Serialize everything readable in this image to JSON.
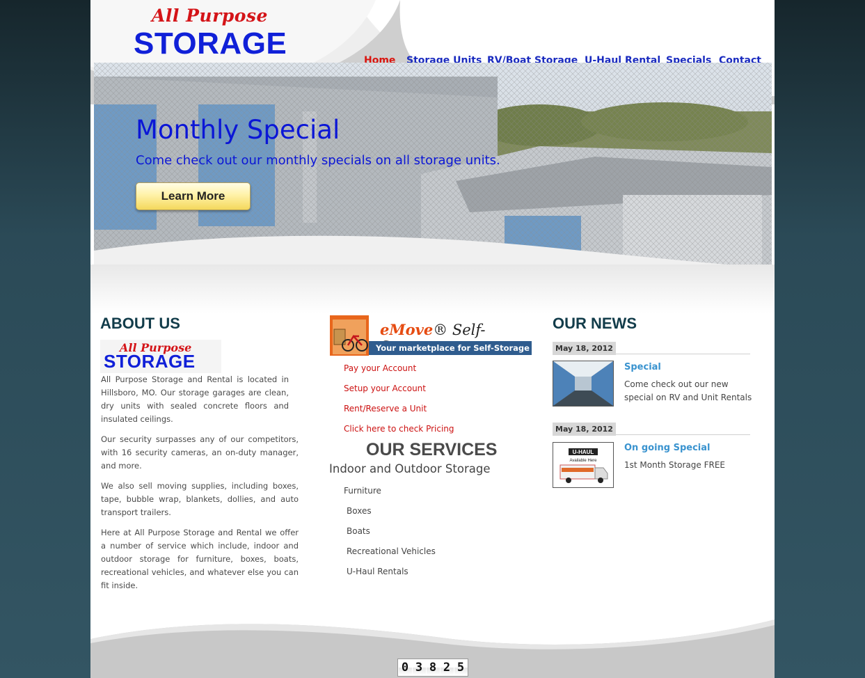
{
  "logo": {
    "script": "All Purpose",
    "main": "STORAGE"
  },
  "nav": {
    "items": [
      {
        "label": "Home",
        "active": true
      },
      {
        "label": "Storage Units",
        "active": false
      },
      {
        "label": "RV/Boat Storage",
        "active": false
      },
      {
        "label": "U-Haul Rental",
        "active": false
      },
      {
        "label": "Specials",
        "active": false
      },
      {
        "label": "Contact",
        "active": false
      }
    ]
  },
  "hero": {
    "title": "Monthly Special",
    "subtitle": "Come check out our monthly specials on all storage units.",
    "button": "Learn More"
  },
  "about": {
    "title": "ABOUT US",
    "logo_script": "All Purpose",
    "logo_main": "STORAGE",
    "paragraphs": [
      "All Purpose Storage and Rental is located in Hillsboro, MO. Our storage garages are clean, dry units with sealed concrete floors and insulated ceilings.",
      "Our security surpasses any of our competitors, with 16 security cameras, an on-duty manager, and more.",
      "We also sell moving supplies, including boxes, tape, bubble wrap, blankets, dollies, and auto transport trailers.",
      "Here at All Purpose Storage and Rental we offer a number of service which include, indoor and outdoor storage for furniture, boxes, boats, recreational vehicles, and whatever else you can fit inside."
    ]
  },
  "emove": {
    "brand_e": "eMove",
    "brand_rest": "® Self-Storage",
    "tagline": "Your marketplace for Self-Storage",
    "links": [
      "Pay your Account",
      "Setup your Account",
      "Rent/Reserve a Unit",
      "Click here to check Pricing"
    ]
  },
  "services": {
    "title": "OUR SERVICES",
    "subtitle": "Indoor and Outdoor Storage",
    "items": [
      "Furniture",
      "Boxes",
      "Boats",
      "Recreational Vehicles",
      "U-Haul Rentals"
    ]
  },
  "news": {
    "title": "OUR NEWS",
    "items": [
      {
        "date": "May 18, 2012",
        "title": "Special",
        "text": "Come check out our new special on RV and Unit Rentals",
        "thumb_icon": "storage-hallway-photo"
      },
      {
        "date": "May 18, 2012",
        "title": "On going Special",
        "text": "1st Month Storage FREE",
        "thumb_icon": "uhaul-truck-photo",
        "thumb_label": "U-HAUL",
        "thumb_caption": "Available Here"
      }
    ]
  },
  "counter": {
    "digits": [
      "0",
      "3",
      "8",
      "2",
      "5"
    ]
  },
  "colors": {
    "nav_link": "#1a2bbf",
    "nav_active": "#d9150f",
    "hero_text": "#0b16d6",
    "section_title": "#123c4a",
    "news_title": "#3a93cf",
    "red_link": "#cc1111"
  }
}
